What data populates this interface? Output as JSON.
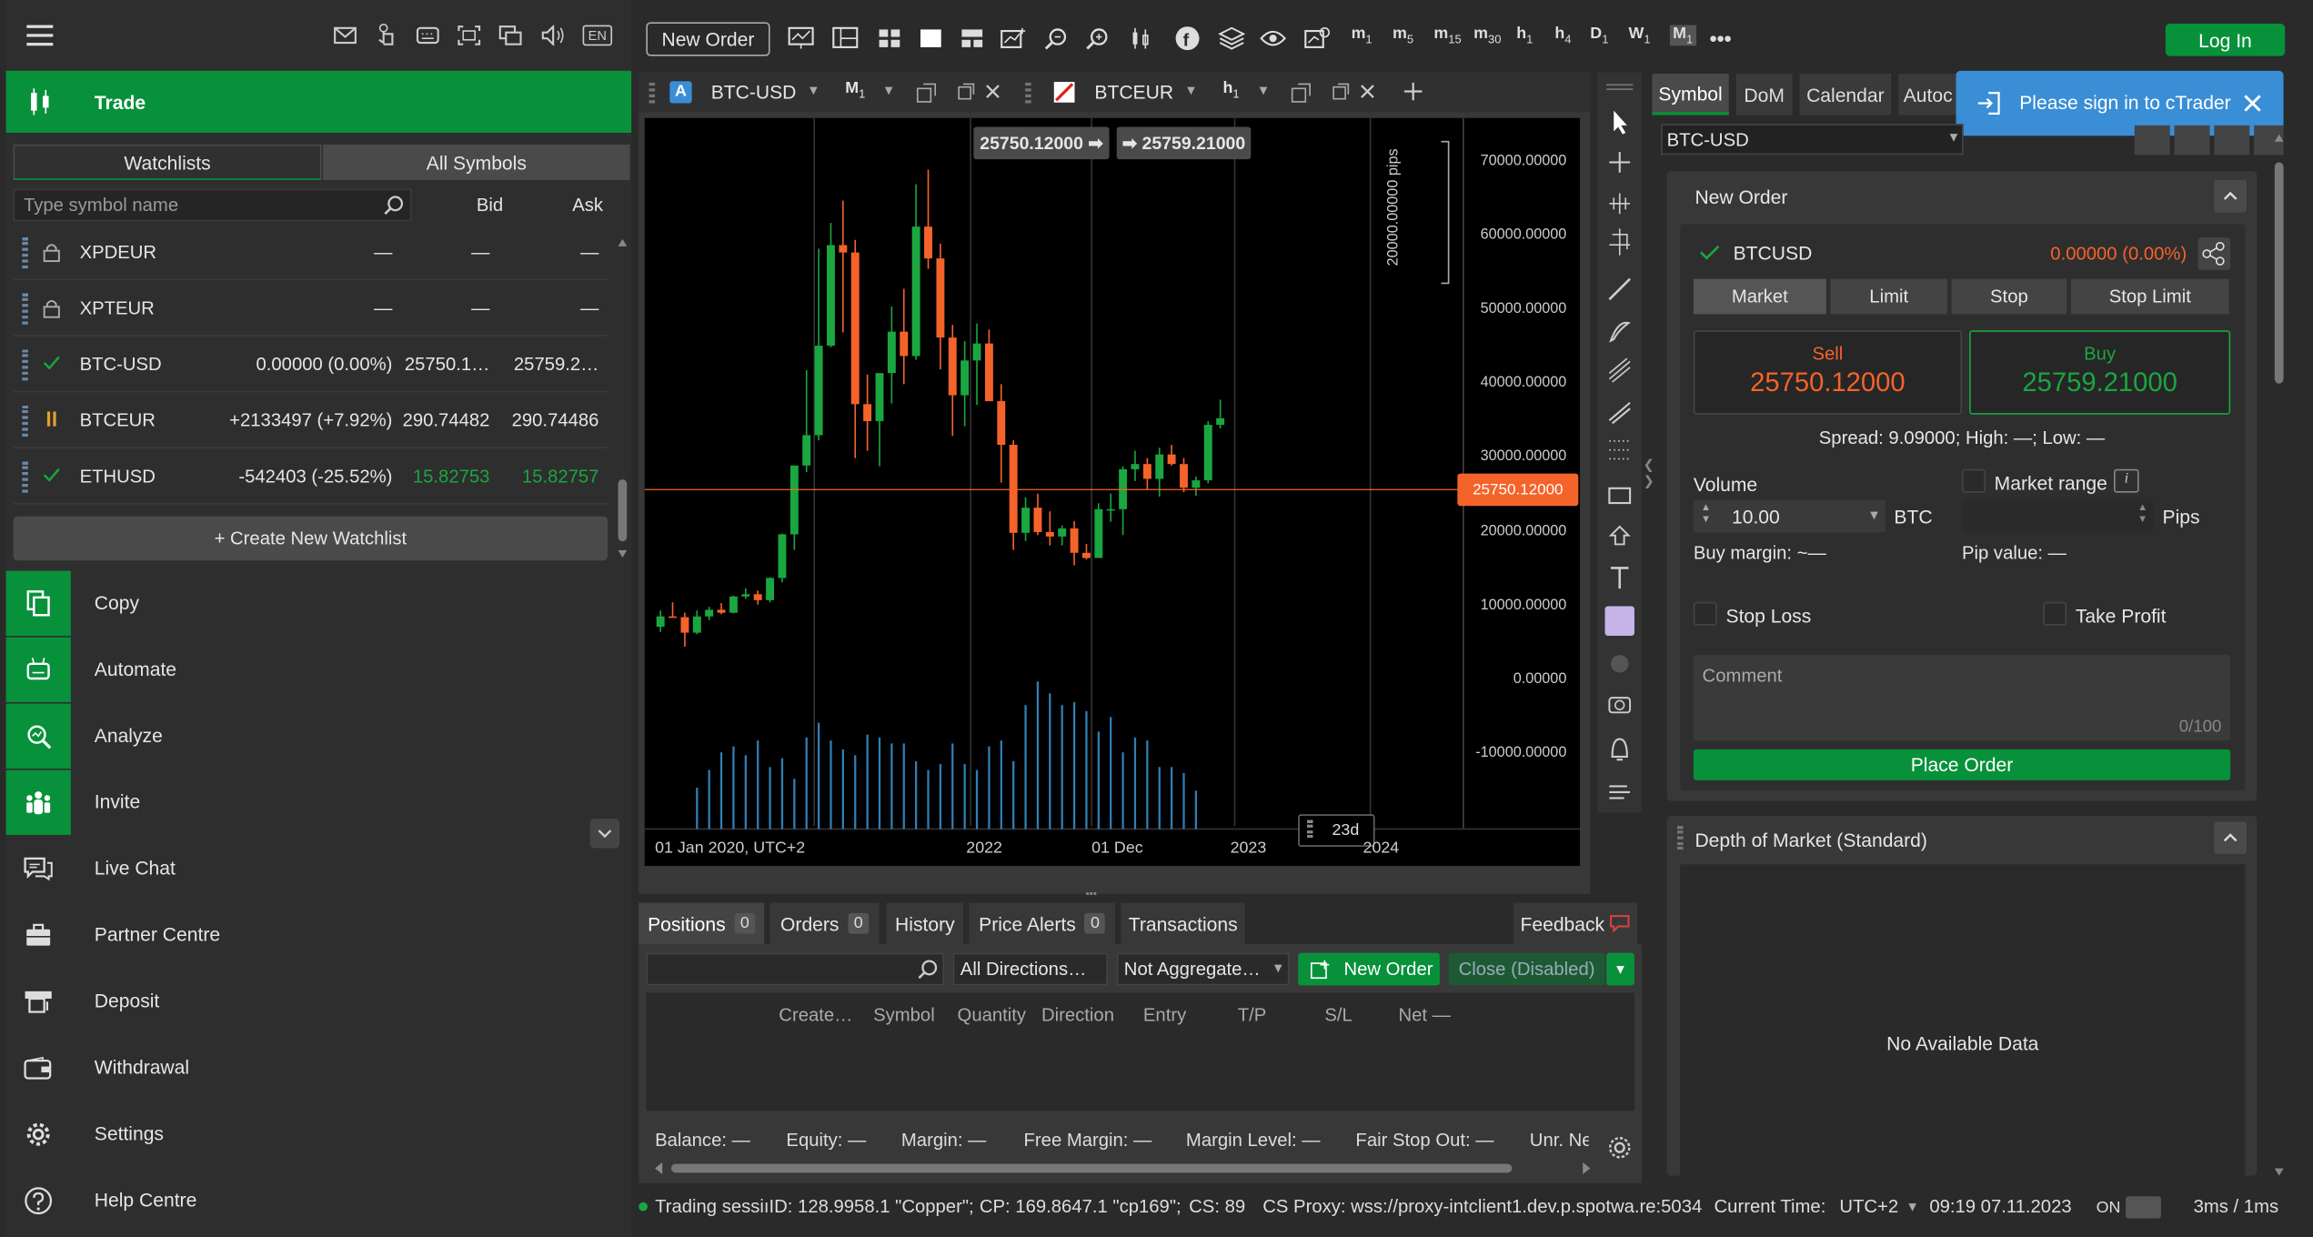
{
  "header": {
    "language": "EN"
  },
  "trade_section": {
    "label": "Trade"
  },
  "watchlist": {
    "tabs": [
      "Watchlists",
      "All Symbols"
    ],
    "search_placeholder": "Type symbol name",
    "col_bid": "Bid",
    "col_ask": "Ask",
    "rows": [
      {
        "symbol": "XPDEUR",
        "change": "—",
        "bid": "—",
        "ask": "—",
        "status": "lock"
      },
      {
        "symbol": "XPTEUR",
        "change": "—",
        "bid": "—",
        "ask": "—",
        "status": "lock"
      },
      {
        "symbol": "BTC-USD",
        "change": "0.00000 (0.00%)",
        "bid": "25750.1…",
        "ask": "25759.2…",
        "status": "check"
      },
      {
        "symbol": "BTCEUR",
        "change": "+2133497 (+7.92%)",
        "bid": "290.74482",
        "ask": "290.74486",
        "status": "pause"
      },
      {
        "symbol": "ETHUSD",
        "change": "-542403 (-25.52%)",
        "bid": "15.82753",
        "ask": "15.82757",
        "status": "check"
      }
    ],
    "create_label": "+ Create New Watchlist"
  },
  "menu": [
    {
      "label": "Copy",
      "icon": "copy-icon",
      "green": true
    },
    {
      "label": "Automate",
      "icon": "robot-icon",
      "green": true
    },
    {
      "label": "Analyze",
      "icon": "analyze-icon",
      "green": true
    },
    {
      "label": "Invite",
      "icon": "people-icon",
      "green": true
    },
    {
      "label": "Live Chat",
      "icon": "chat-icon",
      "green": false
    },
    {
      "label": "Partner Centre",
      "icon": "briefcase-icon",
      "green": false
    },
    {
      "label": "Deposit",
      "icon": "deposit-icon",
      "green": false
    },
    {
      "label": "Withdrawal",
      "icon": "wallet-icon",
      "green": false
    },
    {
      "label": "Settings",
      "icon": "gear-icon",
      "green": false
    },
    {
      "label": "Help Centre",
      "icon": "help-icon",
      "green": false
    }
  ],
  "toolbar": {
    "new_order": "New Order",
    "login": "Log In",
    "timeframes": [
      {
        "l": "m",
        "s": "1"
      },
      {
        "l": "m",
        "s": "5"
      },
      {
        "l": "m",
        "s": "15"
      },
      {
        "l": "m",
        "s": "30"
      },
      {
        "l": "h",
        "s": "1"
      },
      {
        "l": "h",
        "s": "4"
      },
      {
        "l": "D",
        "s": "1"
      },
      {
        "l": "W",
        "s": "1"
      },
      {
        "l": "M",
        "s": "1"
      }
    ]
  },
  "chart_tabs": [
    {
      "symbol": "BTC-USD",
      "tf": "M",
      "tf_sub": "1",
      "badge": "A"
    },
    {
      "symbol": "BTCEUR",
      "tf": "h",
      "tf_sub": "1",
      "badge": ""
    }
  ],
  "chart": {
    "sell_label": "25750.12000",
    "buy_label": "25759.21000",
    "pips_label": "20000.00000 pips",
    "current_price": "25750.12000",
    "range_badge": "23d",
    "y_labels": [
      "70000.00000",
      "60000.00000",
      "50000.00000",
      "40000.00000",
      "30000.00000",
      "20000.00000",
      "10000.00000",
      "0.00000",
      "-10000.00000"
    ],
    "x_labels": [
      "01 Jan 2020, UTC+2",
      "2022",
      "01 Dec",
      "2023",
      "2024"
    ]
  },
  "chart_data": {
    "type": "candlestick",
    "x_start": "2020-01",
    "interval": "1 month",
    "ylim": [
      -10000,
      72000
    ],
    "candles": [
      [
        7200,
        9400,
        6500,
        8600
      ],
      [
        8600,
        10500,
        8500,
        8500
      ],
      [
        8500,
        9100,
        4500,
        6400
      ],
      [
        6400,
        9400,
        6200,
        8600
      ],
      [
        8600,
        9900,
        8100,
        9500
      ],
      [
        9500,
        10400,
        8900,
        9100
      ],
      [
        9100,
        11400,
        9000,
        11300
      ],
      [
        11300,
        12400,
        11000,
        11600
      ],
      [
        11600,
        12100,
        10200,
        10800
      ],
      [
        10800,
        13900,
        10500,
        13800
      ],
      [
        13800,
        19800,
        13200,
        19700
      ],
      [
        19700,
        29000,
        17600,
        29000
      ],
      [
        29000,
        41900,
        28100,
        33100
      ],
      [
        33100,
        58300,
        32400,
        45200
      ],
      [
        45200,
        61800,
        45000,
        58800
      ],
      [
        58800,
        64800,
        47000,
        57800
      ],
      [
        57800,
        59500,
        30000,
        37300
      ],
      [
        37300,
        41300,
        31000,
        35000
      ],
      [
        35000,
        36600,
        28900,
        41500
      ],
      [
        41500,
        50500,
        37400,
        47100
      ],
      [
        47100,
        52900,
        40000,
        43800
      ],
      [
        43800,
        67000,
        43300,
        61300
      ],
      [
        61300,
        69000,
        55600,
        57000
      ],
      [
        57000,
        59000,
        42000,
        46300
      ],
      [
        46300,
        48000,
        33000,
        38500
      ],
      [
        38500,
        45800,
        34300,
        43200
      ],
      [
        43200,
        48200,
        37200,
        45500
      ],
      [
        45500,
        47400,
        37700,
        37700
      ],
      [
        37700,
        40000,
        26700,
        31800
      ],
      [
        31800,
        32400,
        17600,
        19900
      ],
      [
        19900,
        24700,
        18800,
        23300
      ],
      [
        23300,
        25200,
        19600,
        20000
      ],
      [
        20000,
        22800,
        18200,
        19400
      ],
      [
        19400,
        20900,
        18200,
        20500
      ],
      [
        20500,
        21500,
        15500,
        17200
      ],
      [
        17200,
        18400,
        16300,
        16500
      ],
      [
        16500,
        23900,
        16500,
        23100
      ],
      [
        23100,
        25200,
        21400,
        23100
      ],
      [
        23100,
        28900,
        19600,
        28500
      ],
      [
        28500,
        31000,
        26900,
        29200
      ],
      [
        29200,
        30000,
        25800,
        27200
      ],
      [
        27200,
        31400,
        24800,
        30500
      ],
      [
        30500,
        31800,
        29000,
        29200
      ],
      [
        29200,
        30000,
        25400,
        26000
      ],
      [
        26000,
        27500,
        24900,
        27000
      ],
      [
        27000,
        35000,
        26600,
        34500
      ],
      [
        34500,
        37900,
        34000,
        35400
      ]
    ],
    "volume": [
      0,
      0,
      0,
      0,
      0,
      0,
      0,
      0,
      0,
      0,
      0,
      0,
      0,
      0,
      0,
      0,
      0,
      0,
      0,
      0,
      0,
      0,
      0,
      0,
      0,
      0,
      0,
      0,
      0,
      0,
      0,
      0,
      0,
      0,
      0,
      0,
      0,
      0,
      0,
      0,
      0,
      0,
      0,
      0,
      0,
      0,
      0
    ],
    "current_price": 25750.12
  },
  "right_tabs": [
    "Symbol",
    "DoM",
    "Calendar",
    "Autoc"
  ],
  "signin_toast": "Please sign in to cTrader",
  "symbol_select": "BTC-USD",
  "new_order": {
    "title": "New Order",
    "symbol": "BTCUSD",
    "change": "0.00000 (0.00%)",
    "types": [
      "Market",
      "Limit",
      "Stop",
      "Stop Limit"
    ],
    "sell_label": "Sell",
    "sell_price": "25750.12000",
    "buy_label": "Buy",
    "buy_price": "25759.21000",
    "spread": "Spread: 9.09000; High: —; Low: —",
    "volume_label": "Volume",
    "volume_value": "10.00",
    "volume_unit": "BTC",
    "market_range": "Market range",
    "pips": "Pips",
    "buy_margin": "Buy margin: ~—",
    "pip_value": "Pip value: —",
    "stop_loss": "Stop Loss",
    "take_profit": "Take Profit",
    "comment_placeholder": "Comment",
    "comment_count": "0/100",
    "place_order": "Place Order"
  },
  "dom": {
    "title": "Depth of Market (Standard)",
    "empty": "No Available Data"
  },
  "bottom": {
    "tabs": [
      {
        "label": "Positions",
        "count": "0"
      },
      {
        "label": "Orders",
        "count": "0"
      },
      {
        "label": "History",
        "count": ""
      },
      {
        "label": "Price Alerts",
        "count": "0"
      },
      {
        "label": "Transactions",
        "count": ""
      }
    ],
    "feedback": "Feedback",
    "directions": "All Directions…",
    "aggregate": "Not Aggregate…",
    "new_order": "New Order",
    "close": "Close (Disabled)",
    "columns": [
      "Create…",
      "Symbol",
      "Quantity",
      "Direction",
      "Entry",
      "T/P",
      "S/L",
      "Net —"
    ],
    "summary": [
      "Balance: —",
      "Equity: —",
      "Margin: —",
      "Free Margin: —",
      "Margin Level: —",
      "Fair Stop Out: —",
      "Unr. Ne"
    ]
  },
  "status": {
    "session": "Trading sessiıID: 128.9958.1 \"Copper\";",
    "cp": "CP: 169.8647.1 \"cp169\";",
    "cs": "CS: 89",
    "proxy": "CS Proxy: wss://proxy-intclient1.dev.p.spotwa.re:5034",
    "time_label": "Current Time:",
    "tz": "UTC+2",
    "time": "09:19 07.11.2023",
    "on": "ON",
    "latency": "3ms / 1ms"
  },
  "colors": {
    "green": "#08913b",
    "up": "#1aa640",
    "down": "#f4632a",
    "accent": "#3a8ed6"
  }
}
